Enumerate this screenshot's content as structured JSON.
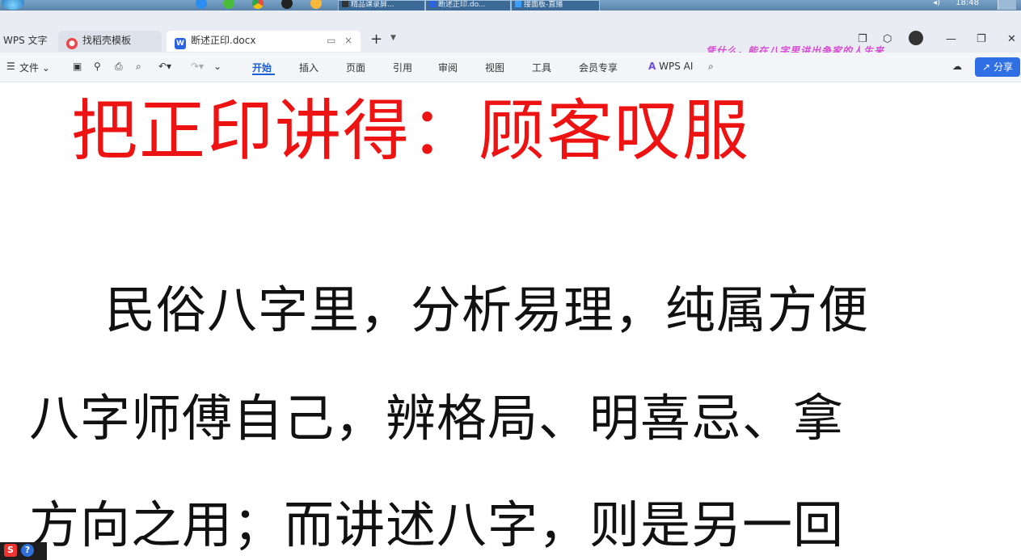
{
  "taskbar": {
    "tasks": [
      {
        "label": "精品课录屏..."
      },
      {
        "label": "断述正印.do..."
      },
      {
        "label": "接面板-直播"
      }
    ],
    "clock": "18:48"
  },
  "tabs": {
    "app_label": "WPS 文字",
    "template_label": "找稻壳模板",
    "doc_label": "断述正印.docx",
    "add_symbol": "+",
    "close_symbol": "×"
  },
  "marquee": "凭什么，能在八字里讲出争家的人生来",
  "menubar": {
    "file_label": "文件",
    "tabs": [
      "开始",
      "插入",
      "页面",
      "引用",
      "审阅",
      "视图",
      "工具",
      "会员专享"
    ],
    "ai_label": "WPS AI",
    "share_label": "分享"
  },
  "document": {
    "title": "把正印讲得：顾客叹服",
    "lines": [
      "民俗八字里，分析易理，纯属方便",
      "八字师傅自己，辨格局、明喜忌、拿",
      "方向之用；而讲述八字，则是另一回"
    ]
  },
  "tray": {
    "s_label": "S",
    "q_label": "?"
  }
}
